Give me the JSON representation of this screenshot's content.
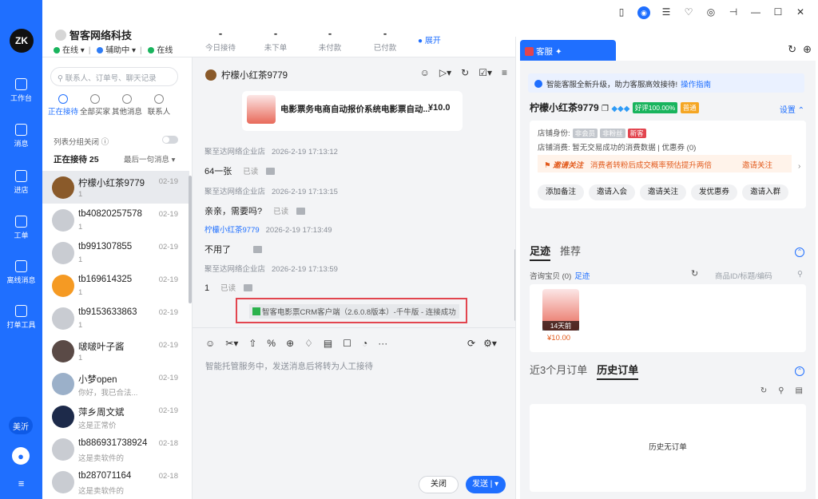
{
  "rail": {
    "logo": "ZK",
    "items": [
      {
        "label": "工作台",
        "icon": "workbench-icon"
      },
      {
        "label": "消息",
        "icon": "message-icon"
      },
      {
        "label": "进店",
        "icon": "store-icon"
      },
      {
        "label": "工单",
        "icon": "ticket-icon"
      },
      {
        "label": "离线消息",
        "icon": "offline-message-icon"
      },
      {
        "label": "打单工具",
        "icon": "print-icon"
      }
    ],
    "badge": "美沂",
    "menu": "≡"
  },
  "header": {
    "shop_name": "智客网络科技",
    "status": {
      "online": "在线",
      "assist": "辅助中",
      "client": "在线"
    },
    "kpis": [
      {
        "value": "-",
        "label": "今日接待"
      },
      {
        "value": "-",
        "label": "未下单"
      },
      {
        "value": "-",
        "label": "未付款"
      },
      {
        "value": "-",
        "label": "已付款"
      }
    ],
    "expand": "展开",
    "window_controls": [
      "▯",
      "◉",
      "☰",
      "♡",
      "◎",
      "⊣",
      "—",
      "☐",
      "✕"
    ]
  },
  "contacts": {
    "search_placeholder": "联系人、订单号、聊天记录",
    "tabs": [
      {
        "label": "正在接待",
        "active": true
      },
      {
        "label": "全部买家",
        "active": false
      },
      {
        "label": "其他消息",
        "active": false
      },
      {
        "label": "联系人",
        "active": false
      }
    ],
    "group_toggle_label": "列表分组关闭",
    "section_title": "正在接待 25",
    "sort_label": "最后一句消息 ▾",
    "rows": [
      {
        "name": "柠檬小红茶9779",
        "date": "02-19",
        "msg": "1",
        "active": true
      },
      {
        "name": "tb40820257578",
        "date": "02-19",
        "msg": "1"
      },
      {
        "name": "tb991307855",
        "date": "02-19",
        "msg": "1"
      },
      {
        "name": "tb169614325",
        "date": "02-19",
        "msg": "1"
      },
      {
        "name": "tb9153633863",
        "date": "02-19",
        "msg": "1"
      },
      {
        "name": "啵啵叶子酱",
        "date": "02-19",
        "msg": "1"
      },
      {
        "name": "小梦open",
        "date": "02-19",
        "msg": "你好，我已合法..."
      },
      {
        "name": "萍乡周文斌",
        "date": "02-19",
        "msg": "这是正常价"
      },
      {
        "name": "tb886931738924",
        "date": "02-18",
        "msg": "这是卖软件的"
      },
      {
        "name": "tb287071164",
        "date": "02-18",
        "msg": "这是卖软件的"
      }
    ]
  },
  "chat": {
    "name": "柠檬小红茶9779",
    "product_card": {
      "title": "电影票务电商自动报价系统电影票自动...",
      "price": "¥10.0"
    },
    "messages": [
      {
        "sender": "聚至达网络企业店",
        "time": "2026-2-19 17:13:12",
        "text": "64一张",
        "read": "已读"
      },
      {
        "sender": "聚至达网络企业店",
        "time": "2026-2-19 17:13:15",
        "text": "亲亲，需要吗?",
        "read": "已读"
      },
      {
        "sender": "柠檬小红茶9779",
        "time": "2026-2-19 17:13:49",
        "text": "不用了",
        "read": ""
      },
      {
        "sender": "聚至达网络企业店",
        "time": "2026-2-19 17:13:59",
        "text": "1",
        "read": "已读"
      }
    ],
    "system_notice": "智客电影票CRM客户端（2.6.0.8版本）-千牛版 - 连接成功",
    "composer_placeholder": "智能托管服务中，发送消息后将转为人工接待",
    "close_label": "关闭",
    "send_label": "发送 | ▾"
  },
  "panel": {
    "tab_label": "客服",
    "notice": "智能客服全新升级，助力客服高效接待!",
    "notice_link": "操作指南",
    "customer_name": "柠檬小红茶9779",
    "good_rate": "好评100.00%",
    "level": "普通",
    "settings": "设置",
    "shop_identity_label": "店铺身份:",
    "tags": [
      "非会员",
      "非粉丝",
      "新客"
    ],
    "consume_label": "店铺消费:",
    "consume_value": "暂无交易成功的消费数据 | 优惠券 (0)",
    "invite_title": "邀请关注",
    "invite_desc": "消费者转粉后成交概率预估提升两倍",
    "invite_action": "邀请关注",
    "chips": [
      "添加备注",
      "邀请入会",
      "邀请关注",
      "发优惠券",
      "邀请入群"
    ],
    "footprint_tab": "足迹",
    "recommend_tab": "推荐",
    "inquiry_label": "咨询宝贝 (0)",
    "footprint_link": "足迹",
    "product_search_placeholder": "商品ID/标题/编码",
    "footprint_item": {
      "ago": "14天前",
      "price": "¥10.00"
    },
    "orders_tab_recent": "近3个月订单",
    "orders_tab_history": "历史订单",
    "empty_orders": "历史无订单"
  }
}
